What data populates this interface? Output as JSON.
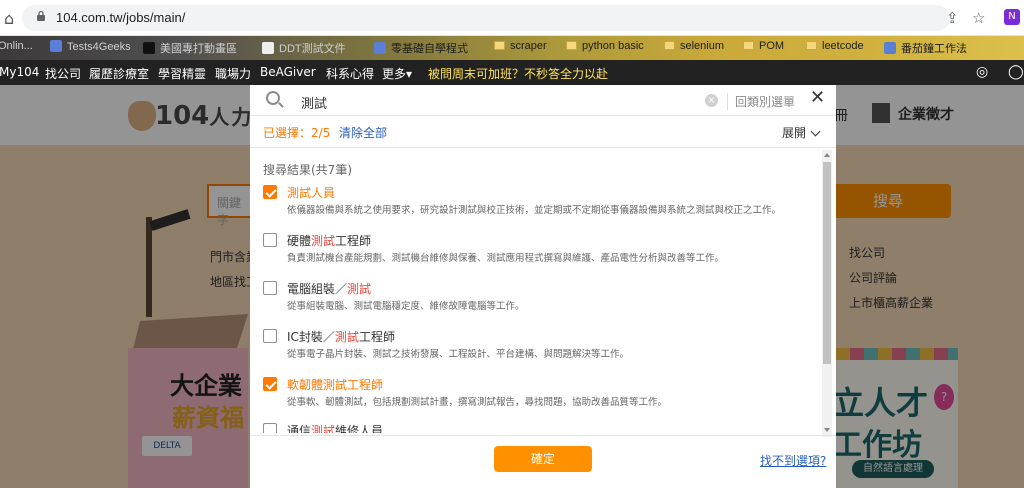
{
  "browser": {
    "url": "104.com.tw/jobs/main/",
    "ext_label": "N",
    "bookmarks": [
      {
        "label": "Onlin..."
      },
      {
        "label": "Tests4Geeks"
      },
      {
        "label": "美國專打動畫區"
      },
      {
        "label": "DDT測試文件"
      },
      {
        "label": "零基礎自學程式"
      },
      {
        "label": "scraper"
      },
      {
        "label": "python basic"
      },
      {
        "label": "selenium"
      },
      {
        "label": "POM"
      },
      {
        "label": "leetcode"
      },
      {
        "label": "番茄鐘工作法"
      }
    ]
  },
  "topnav": {
    "items": [
      "My104",
      "找公司",
      "履歷診療室",
      "學習精靈",
      "職場力",
      "BeAGiver",
      "科系心得",
      "更多▾"
    ],
    "promo": "被問周末可加班？不秒答全力以赴"
  },
  "page": {
    "logo_text": "104",
    "logo_sub": "人力",
    "register": "冊",
    "hire_label": "企業徵才",
    "search_placeholder": "關鍵字",
    "search_button": "搜尋",
    "left_links": [
      "門市含業",
      "地區找工"
    ],
    "right_links": [
      "找公司",
      "公司評論",
      "上市櫃高薪企業"
    ],
    "banner1_line1": "大企業",
    "banner1_line2": "薪資福",
    "banner1_brand": "DELTA",
    "banner2_line1": "立人才",
    "banner2_line2": "工作坊",
    "banner2_pill": "自然語言處理",
    "banner2_pin": "?"
  },
  "modal": {
    "query": "測試",
    "back_category": "回類別選單",
    "close": "✕",
    "selected_label": "已選擇：",
    "selected_count": "2/5",
    "clear_all": "清除全部",
    "expand": "展開",
    "results_title": "搜尋結果(共7筆)",
    "items": [
      {
        "name_pre": "測試人員",
        "name_hl": "",
        "name_post": "",
        "desc": "依儀器設備與系統之使用要求，研究設計測試與校正技術，並定期或不定期從事儀器設備與系統之測試與校正之工作。",
        "checked": true
      },
      {
        "name_pre": "硬體",
        "name_hl": "測試",
        "name_post": "工程師",
        "desc": "負責測試機台產能規劃、測試機台維修與保養、測試應用程式撰寫與維護、產品電性分析與改善等工作。",
        "checked": false
      },
      {
        "name_pre": "電腦組裝／",
        "name_hl": "測試",
        "name_post": "",
        "desc": "從事組裝電腦、測試電腦穩定度、維修故障電腦等工作。",
        "checked": false
      },
      {
        "name_pre": "IC封裝／",
        "name_hl": "測試",
        "name_post": "工程師",
        "desc": "從事電子晶片封裝、測試之技術發展、工程設計、平台建構、與問題解決等工作。",
        "checked": false
      },
      {
        "name_pre": "軟韌體測試工程師",
        "name_hl": "",
        "name_post": "",
        "desc": "從事軟、韌體測試，包括規劃測試計畫，撰寫測試報告，尋找問題，協助改善品質等工作。",
        "checked": true
      },
      {
        "name_pre": "通信",
        "name_hl": "測試",
        "name_post": "維修人員",
        "desc": "",
        "checked": false
      }
    ],
    "confirm": "確定",
    "not_found": "找不到選項?"
  }
}
